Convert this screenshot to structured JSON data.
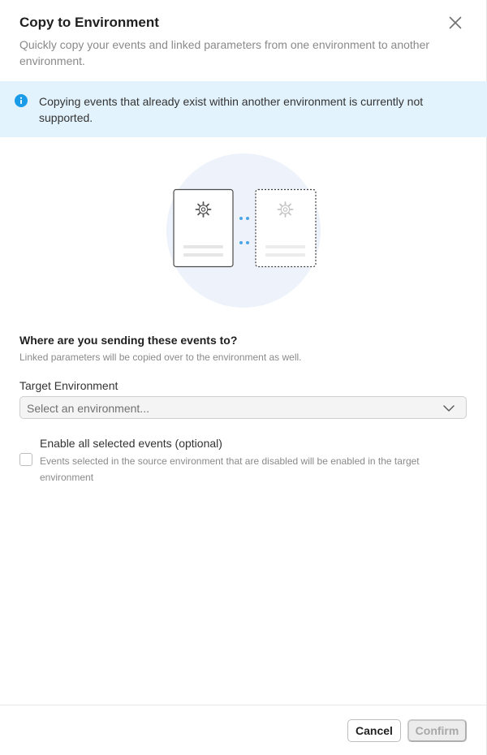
{
  "dialog": {
    "title": "Copy to Environment",
    "subtitle": "Quickly copy your events and linked parameters from one environment to another environment.",
    "close_icon": "close-icon"
  },
  "banner": {
    "icon": "info-icon",
    "text": "Copying events that already exist within another environment is currently not supported.",
    "background": "#e3f3fd",
    "accent": "#1a9be8"
  },
  "illustration": {
    "left_icon": "gear-icon",
    "right_icon": "gear-icon"
  },
  "destination": {
    "title": "Where are you sending these events to?",
    "description": "Linked parameters will be copied over to the environment as well."
  },
  "target_environment": {
    "label": "Target Environment",
    "placeholder": "Select an environment...",
    "icon": "chevron-down-icon"
  },
  "enable_events": {
    "label": "Enable all selected events (optional)",
    "description": "Events selected in the source environment that are disabled will be enabled in the target environment",
    "checked": false
  },
  "footer": {
    "cancel_label": "Cancel",
    "confirm_label": "Confirm"
  }
}
